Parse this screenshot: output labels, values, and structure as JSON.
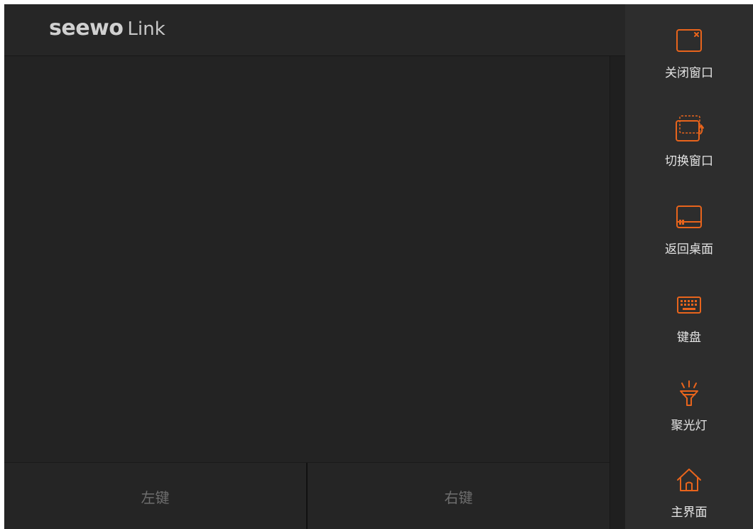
{
  "header": {
    "brand": "seewo",
    "product": "Link"
  },
  "mouse_buttons": {
    "left": "左键",
    "right": "右键"
  },
  "sidebar": {
    "accent_color": "#e8641c",
    "items": [
      {
        "label": "关闭窗口",
        "icon": "close-window-icon"
      },
      {
        "label": "切换窗口",
        "icon": "switch-window-icon"
      },
      {
        "label": "返回桌面",
        "icon": "desktop-icon"
      },
      {
        "label": "键盘",
        "icon": "keyboard-icon"
      },
      {
        "label": "聚光灯",
        "icon": "spotlight-icon"
      },
      {
        "label": "主界面",
        "icon": "home-icon"
      }
    ]
  }
}
